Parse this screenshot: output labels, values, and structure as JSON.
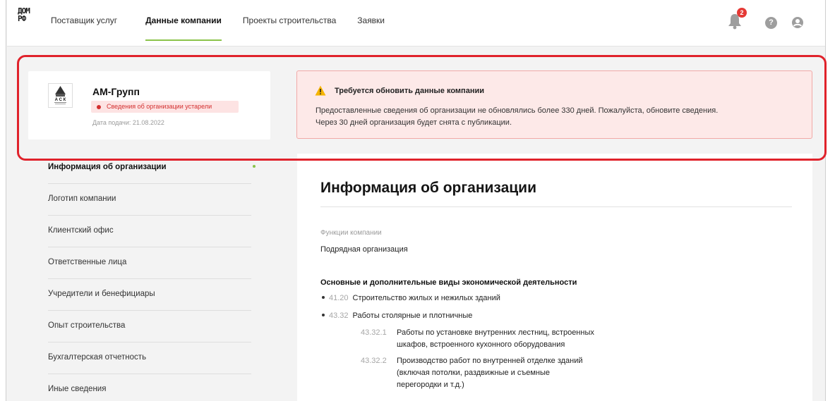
{
  "header": {
    "logo_top": "ДОМ",
    "logo_bottom": "РФ",
    "nav": [
      {
        "label": "Поставщик услуг",
        "active": false
      },
      {
        "label": "Данные компании",
        "active": true
      },
      {
        "label": "Проекты строительства",
        "active": false
      },
      {
        "label": "Заявки",
        "active": false
      }
    ],
    "notifications_count": "2",
    "help_label": "?"
  },
  "company": {
    "name": "АМ-Групп",
    "logo_text": "А С К",
    "status": "Сведения об организации устарели",
    "submit_date": "Дата подачи: 21.08.2022"
  },
  "alert": {
    "title": "Требуется обновить данные компании",
    "line1": "Предоставленные сведения об организации не обновлялись более 330 дней. Пожалуйста, обновите сведения.",
    "line2": "Через 30 дней организация будет снята с публикации."
  },
  "sidebar": {
    "items": [
      {
        "label": "Информация об организации"
      },
      {
        "label": "Логотип компании"
      },
      {
        "label": "Клиентский офис"
      },
      {
        "label": "Ответственные лица"
      },
      {
        "label": "Учредители и бенефициары"
      },
      {
        "label": "Опыт строительства"
      },
      {
        "label": "Бухгалтерская отчетность"
      },
      {
        "label": "Иные сведения"
      }
    ]
  },
  "main": {
    "title": "Информация об организации",
    "functions_label": "Функции компании",
    "functions_value": "Подрядная организация",
    "okved_title": "Основные и дополнительные виды экономической деятельности",
    "okved": [
      {
        "code": "41.20",
        "label": "Строительство жилых и нежилых зданий"
      },
      {
        "code": "43.32",
        "label": "Работы столярные и плотничные"
      }
    ],
    "sub_okved": [
      {
        "code": "43.32.1",
        "line1": "Работы по установке внутренних лестниц, встроенных",
        "line2": "шкафов, встроенного кухонного оборудования",
        "line3": ""
      },
      {
        "code": "43.32.2",
        "line1": "Производство работ по внутренней отделке зданий",
        "line2": "(включая потолки, раздвижные и съемные",
        "line3": "перегородки и т.д.)"
      }
    ]
  },
  "colors": {
    "accent": "#8bc34a",
    "danger": "#e0222b",
    "alert_bg": "#fde9e8"
  }
}
